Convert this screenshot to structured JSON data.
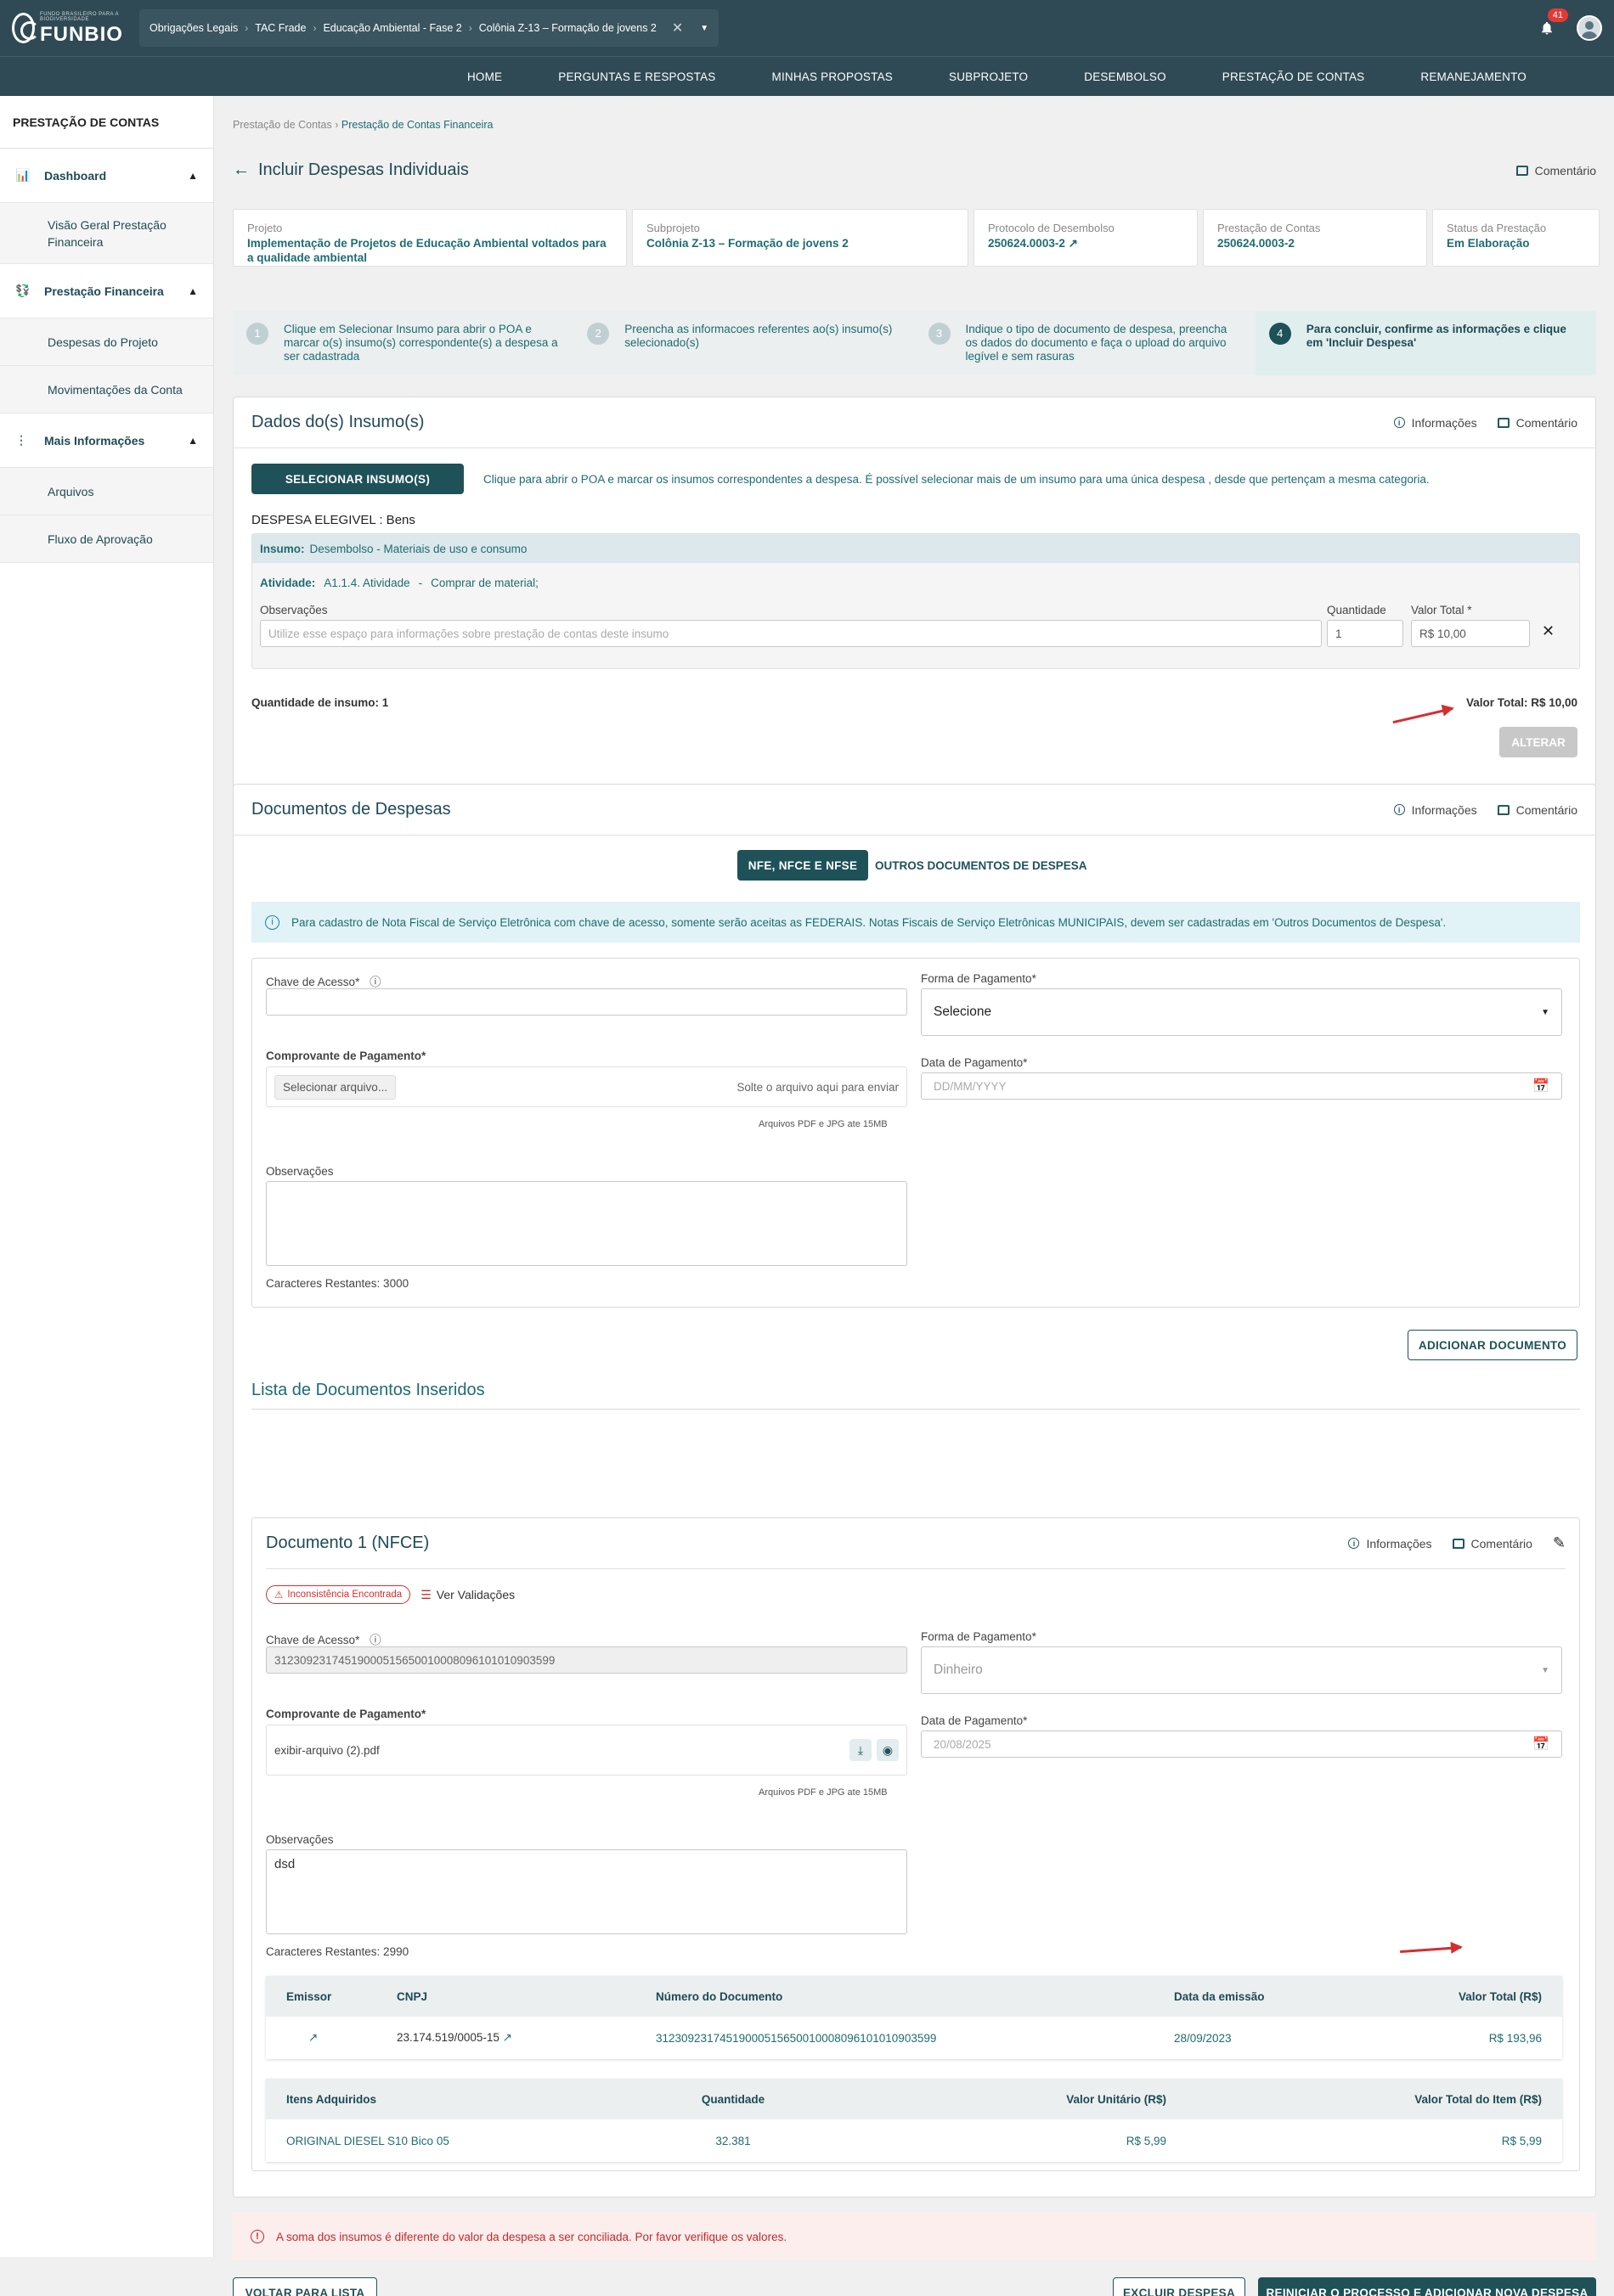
{
  "header": {
    "logo_small": "FUNDO BRASILEIRO PARA A BIODIVERSIDADE",
    "logo_big": "FUNBIO",
    "crumbs": [
      "Obrigações Legais",
      "TAC Frade",
      "Educação Ambiental - Fase 2",
      "Colônia Z-13 – Formação de jovens 2"
    ],
    "notifications": "41"
  },
  "nav": [
    "HOME",
    "PERGUNTAS E RESPOSTAS",
    "MINHAS PROPOSTAS",
    "SUBPROJETO",
    "DESEMBOLSO",
    "PRESTAÇÃO DE CONTAS",
    "REMANEJAMENTO"
  ],
  "sidebar": {
    "title": "PRESTAÇÃO DE CONTAS",
    "dashboard": "Dashboard",
    "dashboard_item": "Visão Geral Prestação Financeira",
    "financeira": "Prestação Financeira",
    "fin_items": [
      "Despesas do Projeto",
      "Movimentações da Conta"
    ],
    "mais": "Mais Informações",
    "mais_items": [
      "Arquivos",
      "Fluxo de Aprovação"
    ]
  },
  "page": {
    "breadcrumb": [
      "Prestação de Contas",
      "Prestação de Contas Financeira"
    ],
    "title": "Incluir Despesas Individuais",
    "comment": "Comentário",
    "info": "Informações"
  },
  "cards": [
    {
      "label": "Projeto",
      "value": "Implementação de Projetos de Educação Ambiental voltados para a qualidade ambiental"
    },
    {
      "label": "Subprojeto",
      "value": "Colônia Z-13 – Formação de jovens 2"
    },
    {
      "label": "Protocolo de Desembolso",
      "value": "250624.0003-2"
    },
    {
      "label": "Prestação de Contas",
      "value": "250624.0003-2"
    },
    {
      "label": "Status da Prestação",
      "value": "Em Elaboração"
    }
  ],
  "steps": [
    {
      "n": "1",
      "text": "Clique em Selecionar Insumo para abrir o POA e marcar o(s) insumo(s) correspondente(s) a despesa a ser cadastrada"
    },
    {
      "n": "2",
      "text": "Preencha as informacoes referentes ao(s) insumo(s) selecionado(s)"
    },
    {
      "n": "3",
      "text": "Indique o tipo de documento de despesa, preencha os dados do documento e faça o upload do arquivo legível e sem rasuras"
    },
    {
      "n": "4",
      "text": "Para concluir, confirme as informações e clique em 'Incluir Despesa'"
    }
  ],
  "insumos": {
    "title": "Dados do(s) Insumo(s)",
    "select_btn": "SELECIONAR INSUMO(S)",
    "hint": "Clique para abrir o POA e marcar os insumos correspondentes a despesa. É possível selecionar mais de um insumo para uma única despesa , desde que pertençam a mesma categoria.",
    "category": "DESPESA ELEGIVEL : Bens",
    "insumo_label": "Insumo:",
    "insumo_value": "Desembolso - Materiais de uso e consumo",
    "atividade_label": "Atividade:",
    "atividade_value": "A1.1.4. Atividade",
    "atividade_dash": "-",
    "atividade_desc": "Comprar de material;",
    "obs_label": "Observações",
    "obs_placeholder": "Utilize esse espaço para informações sobre prestação de contas deste insumo",
    "qtd_label": "Quantidade",
    "qtd_value": "1",
    "valor_label": "Valor Total *",
    "valor_value": "R$ 10,00",
    "qtd_insumo": "Quantidade de insumo: 1",
    "valor_total": "Valor Total: R$ 10,00",
    "alterar": "ALTERAR"
  },
  "docs": {
    "title": "Documentos de Despesas",
    "tab1": "NFE, NFCE E NFSE",
    "tab2": "OUTROS DOCUMENTOS DE DESPESA",
    "notice": "Para cadastro de Nota Fiscal de Serviço Eletrônica com chave de acesso, somente serão aceitas as FEDERAIS. Notas Fiscais de Serviço Eletrônicas MUNICIPAIS, devem ser cadastradas em 'Outros Documentos de Despesa'.",
    "chave_label": "Chave de Acesso*",
    "forma_label": "Forma de Pagamento*",
    "forma_value": "Selecione",
    "comprovante_label": "Comprovante de Pagamento*",
    "select_file": "Selecionar arquivo...",
    "drop": "Solte o arquivo aqui para enviar",
    "file_hint": "Arquivos PDF e JPG ate 15MB",
    "data_label": "Data de Pagamento*",
    "data_placeholder": "DD/MM/YYYY",
    "obs_label": "Observações",
    "remaining": "Caracteres Restantes: 3000",
    "add_btn": "ADICIONAR DOCUMENTO"
  },
  "list": {
    "title": "Lista de Documentos Inseridos",
    "doc_title": "Documento 1 (NFCE)",
    "inconsistencia": "Inconsistência Encontrada",
    "ver": "Ver Validações",
    "chave_label": "Chave de Acesso*",
    "chave_value": "31230923174519000515650010008096101010903599",
    "forma_label": "Forma de Pagamento*",
    "forma_value": "Dinheiro",
    "comprovante_label": "Comprovante de Pagamento*",
    "file_name": "exibir-arquivo (2).pdf",
    "file_hint": "Arquivos PDF e JPG ate 15MB",
    "data_label": "Data de Pagamento*",
    "data_value": "20/08/2025",
    "obs_label": "Observações",
    "obs_value": "dsd",
    "remaining": "Caracteres Restantes: 2990",
    "head": [
      "Emissor",
      "CNPJ",
      "Número do Documento",
      "Data da emissão",
      "Valor Total (R$)"
    ],
    "row": {
      "cnpj": "23.174.519/0005-15",
      "numero": "31230923174519000515650010008096101010903599",
      "data": "28/09/2023",
      "valor": "R$ 193,96"
    },
    "items_head": [
      "Itens Adquiridos",
      "Quantidade",
      "Valor Unitário (R$)",
      "Valor Total do Item (R$)"
    ],
    "item": {
      "nome": "ORIGINAL DIESEL S10 Bico 05",
      "qtd": "32.381",
      "unit": "R$ 5,99",
      "total": "R$ 5,99"
    }
  },
  "error": "A soma dos insumos é diferente do valor da despesa a ser conciliada. Por favor verifique os valores.",
  "footer": {
    "voltar": "VOLTAR PARA LISTA",
    "excluir": "EXCLUIR DESPESA",
    "reiniciar": "REINICIAR O PROCESSO E ADICIONAR NOVA DESPESA"
  }
}
